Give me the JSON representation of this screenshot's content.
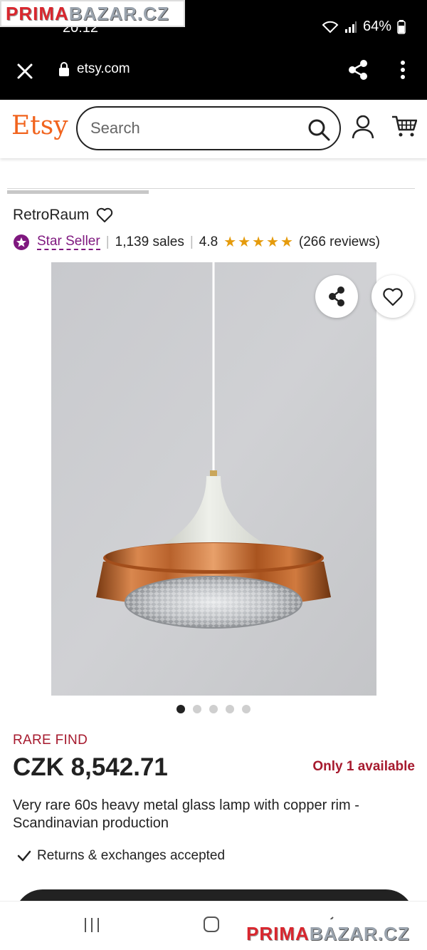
{
  "status_bar": {
    "time": "20:12",
    "battery": "64%"
  },
  "watermark": {
    "part_a": "PRIMA",
    "part_b": "BAZAR.CZ"
  },
  "browser": {
    "url": "etsy.com"
  },
  "header": {
    "logo": "Etsy",
    "search_placeholder": "Search"
  },
  "shop": {
    "name": "RetroRaum",
    "badge": "Star Seller",
    "sales": "1,139 sales",
    "rating": "4.8",
    "rating_stars": 5,
    "reviews": "(266 reviews)"
  },
  "carousel": {
    "total_images": 5,
    "active_index": 0
  },
  "product": {
    "tag": "RARE FIND",
    "price": "CZK 8,542.71",
    "availability": "Only 1 available",
    "title": "Very rare 60s heavy metal glass lamp with copper rim - Scandinavian production",
    "returns": "Returns & exchanges accepted"
  },
  "colors": {
    "etsy_orange": "#f1641e",
    "star_seller_purple": "#7f187f",
    "alert_red": "#a61a2e",
    "star_gold": "#e59b0c"
  }
}
